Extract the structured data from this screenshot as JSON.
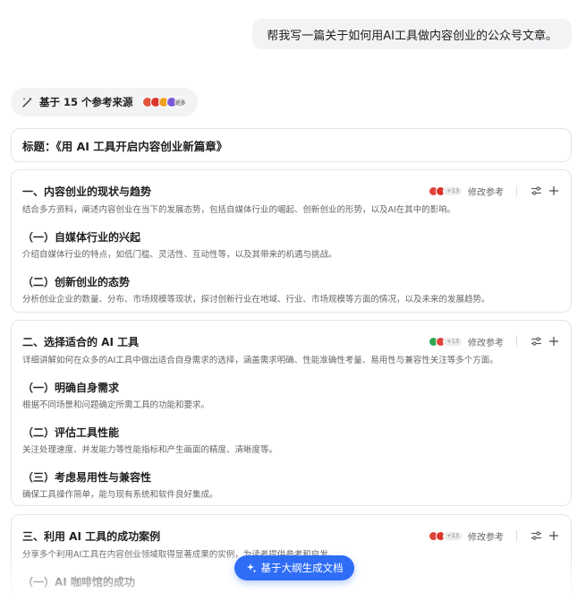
{
  "user_message": "帮我写一篇关于如何用AI工具做内容创业的公众号文章。",
  "sources": {
    "label": "基于 15 个参考来源",
    "favicons": [
      "#e5533d",
      "#d9362b",
      "#f0a020",
      "#7a5ad8"
    ],
    "more": "更多"
  },
  "title_line": "标题：《用 AI 工具开启内容创业新篇章》",
  "edit_ref_label": "修改参考",
  "sections": [
    {
      "title": "一、内容创业的现状与趋势",
      "desc": "结合多方资料，阐述内容创业在当下的发展态势，包括自媒体行业的崛起、创新创业的形势，以及AI在其中的影响。",
      "source_count": "+13",
      "source_colors": [
        "#e0443a",
        "#d9362b"
      ],
      "subs": [
        {
          "title": "（一）自媒体行业的兴起",
          "desc": "介绍自媒体行业的特点，如低门槛、灵活性、互动性等，以及其带来的机遇与挑战。"
        },
        {
          "title": "（二）创新创业的态势",
          "desc": "分析创业企业的数量、分布、市场规模等现状，探讨创新行业在地域、行业、市场规模等方面的情况，以及未来的发展趋势。"
        }
      ]
    },
    {
      "title": "二、选择适合的 AI 工具",
      "desc": "详细讲解如何在众多的AI工具中做出适合自身需求的选择，涵盖需求明确、性能准确性考量、易用性与兼容性关注等多个方面。",
      "source_count": "+13",
      "source_colors": [
        "#2fa84f",
        "#e0443a"
      ],
      "subs": [
        {
          "title": "（一）明确自身需求",
          "desc": "根据不同场景和问题确定所需工具的功能和要求。"
        },
        {
          "title": "（二）评估工具性能",
          "desc": "关注处理速度、并发能力等性能指标和产生画面的精度、清晰度等。"
        },
        {
          "title": "（三）考虑易用性与兼容性",
          "desc": "确保工具操作简单，能与现有系统和软件良好集成。"
        }
      ]
    },
    {
      "title": "三、利用 AI 工具的成功案例",
      "desc": "分享多个利用AI工具在内容创业领域取得显著成果的实例，为读者提供参考和启发。",
      "source_count": "+13",
      "source_colors": [
        "#e0443a",
        "#d9362b"
      ],
      "subs": [
        {
          "title": "（一）AI 咖啡馆的成功",
          "desc": ""
        }
      ]
    }
  ],
  "generate_button": "基于大纲生成文档"
}
